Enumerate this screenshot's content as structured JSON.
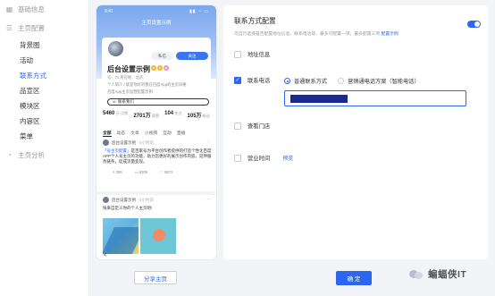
{
  "sidebar": {
    "items": [
      {
        "label": "基础信息",
        "level": "top",
        "icon": "grid-icon"
      },
      {
        "label": "主页配置",
        "level": "top",
        "icon": "layout-icon"
      },
      {
        "label": "背景图",
        "level": "sub"
      },
      {
        "label": "活动",
        "level": "sub"
      },
      {
        "label": "联系方式",
        "level": "sub",
        "active": true
      },
      {
        "label": "品宣区",
        "level": "sub"
      },
      {
        "label": "模块区",
        "level": "sub"
      },
      {
        "label": "内容区",
        "level": "sub"
      },
      {
        "label": "菜单",
        "level": "sub"
      },
      {
        "label": "主页分析",
        "level": "top",
        "icon": "chart-icon"
      }
    ]
  },
  "phone": {
    "status_time": "9:41",
    "status_icons": "▮▮ ◔ ▭",
    "header_title": "主页设置示例",
    "follow_label": "私信",
    "pm_label": "关注",
    "profile_name": "后台设置示例",
    "badge_1": "★",
    "badge_2": "★",
    "badge_3": "◆",
    "line_1": "号：7x  所在地：北京",
    "line_2": "个人简介 / 就是你好的我在百度App的主页风格",
    "line_3": "百度App主页运营配置示例",
    "contact_label": "联系我们",
    "stats": [
      {
        "value": "5460",
        "unit": "万·点赞"
      },
      {
        "value": "2701万",
        "unit": "获赞"
      },
      {
        "value": "104",
        "unit": "关注"
      },
      {
        "value": "105万",
        "unit": "粉丝"
      }
    ],
    "tabs": [
      "全部",
      "动态",
      "文章",
      "小视频",
      "互动",
      "直播"
    ],
    "post_1": {
      "author": "后台设置示例",
      "time": "· 4小时前",
      "text_link": "「号主页配置」",
      "text": "是百家号为平台创作者提供的打造个性化百度APP个人号主页的功能，助力您更好的展示创作内容，延伸服务链条，促成流量变现。",
      "share": "306",
      "comment": "6309",
      "like": "9872"
    },
    "post_2": {
      "author": "后台设置示例",
      "time": "· 4小时前",
      "text": "快来自定义你的个人主页吧!"
    },
    "back": "<"
  },
  "share_button": "分享主页",
  "panel": {
    "title": "联系方式配置",
    "desc": "可自行选择是否配置地址信息、联系电话等，最多可配置一项，最多配置三项",
    "desc_link": "配置示例",
    "toggle_on": true,
    "options": [
      {
        "label": "地址信息",
        "checked": false
      },
      {
        "label": "联系电话",
        "checked": true
      },
      {
        "label": "查看门店",
        "checked": false
      },
      {
        "label": "营业时间",
        "checked": false,
        "link": "预览"
      }
    ],
    "radios": [
      {
        "label": "普通联系方式",
        "checked": true
      },
      {
        "label": "营销通电话方案（智能电话）",
        "checked": false
      }
    ]
  },
  "confirm_button": "确 定",
  "watermark": {
    "text": "蝙蝠侠IT"
  },
  "colors": {
    "accent": "#2d66f0",
    "background": "#f3f4f8"
  }
}
